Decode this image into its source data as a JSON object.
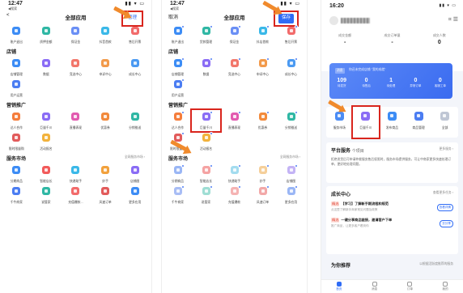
{
  "colors": {
    "accent": "#2f6cf6",
    "highlight": "#d9251d",
    "arrow": "#f08a2c"
  },
  "p1": {
    "time": "12:47",
    "carrier": "◀搜索",
    "signal": "▮▮ ▾ ▭",
    "title": "全部应用",
    "back": "<",
    "manage": "管理",
    "sections": [
      {
        "name": "",
        "items": [
          {
            "label": "账户退出",
            "color": "#3c8cf5"
          },
          {
            "label": "质押金额",
            "color": "#2fb7a4"
          },
          {
            "label": "保证金",
            "color": "#6a8ff5"
          },
          {
            "label": "抖音首款",
            "color": "#3ab8e8"
          },
          {
            "label": "售后开票",
            "color": "#f26b6b"
          }
        ]
      },
      {
        "name": "店铺",
        "items": [
          {
            "label": "店铺管理",
            "color": "#3c8cf5"
          },
          {
            "label": "数据",
            "color": "#8a6cf5"
          },
          {
            "label": "竞选中心",
            "color": "#f2776b"
          },
          {
            "label": "申诉中心",
            "color": "#f29a4b"
          },
          {
            "label": "成长中心",
            "color": "#4b9af2"
          },
          {
            "label": "用户运营",
            "color": "#4b7df2"
          }
        ]
      },
      {
        "name": "营销推广",
        "items": [
          {
            "label": "达人合作",
            "color": "#f57d3c"
          },
          {
            "label": "巨量千川",
            "color": "#8a6cf5"
          },
          {
            "label": "直播表现",
            "color": "#e25bb0"
          },
          {
            "label": "优惠券",
            "color": "#f28a3c"
          },
          {
            "label": "分销推送",
            "color": "#2fb7a4"
          },
          {
            "label": "限时限量购",
            "color": "#e25b5b"
          },
          {
            "label": "活动报名",
            "color": "#f2b23c"
          }
        ]
      },
      {
        "name": "服务市场",
        "more": "全网服务市场 ›",
        "items": [
          {
            "label": "分期商品",
            "color": "#3c8cf5"
          },
          {
            "label": "智能店长",
            "color": "#f25b5b"
          },
          {
            "label": "快递助手",
            "color": "#3ab8e8"
          },
          {
            "label": "妙手",
            "color": "#f2a13c"
          },
          {
            "label": "店铺图 ",
            "color": "#8a6cf5"
          },
          {
            "label": "千牛商家",
            "color": "#4b7df2"
          },
          {
            "label": "说管家",
            "color": "#2fb7a4"
          },
          {
            "label": "充值爆款...",
            "color": "#f26b6b"
          },
          {
            "label": "风速订单",
            "color": "#e25b5b"
          },
          {
            "label": "更多应用",
            "color": "#3c8cf5"
          }
        ]
      }
    ]
  },
  "p2": {
    "time": "12:47",
    "carrier": "◀搜索",
    "signal": "▮▮ ▾ ▭",
    "title": "全部应用",
    "cancel": "取消",
    "save": "保存",
    "sections": [
      {
        "name": "",
        "items": [
          {
            "label": "账户退出",
            "color": "#3c8cf5"
          },
          {
            "label": "货款管理",
            "color": "#2fb7a4"
          },
          {
            "label": "保证金",
            "color": "#6a8ff5"
          },
          {
            "label": "抖店首款",
            "color": "#3ab8e8"
          },
          {
            "label": "售后开票",
            "color": "#f26b6b"
          }
        ]
      },
      {
        "name": "店铺",
        "items": [
          {
            "label": "店铺管理",
            "color": "#3c8cf5"
          },
          {
            "label": "数据",
            "color": "#8a6cf5"
          },
          {
            "label": "竞选中心",
            "color": "#f2776b"
          },
          {
            "label": "申诉中心",
            "color": "#f29a4b"
          },
          {
            "label": "成长中心",
            "color": "#4b9af2"
          },
          {
            "label": "用户运营",
            "color": "#4b7df2"
          }
        ]
      },
      {
        "name": "营销推广",
        "items": [
          {
            "label": "达人合作",
            "color": "#f57d3c"
          },
          {
            "label": "巨量千川",
            "color": "#8a6cf5"
          },
          {
            "label": "直播表现",
            "color": "#e25bb0"
          },
          {
            "label": "优惠券",
            "color": "#f28a3c"
          },
          {
            "label": "分销推送",
            "color": "#2fb7a4"
          },
          {
            "label": "限时限量购",
            "color": "#e25b5b"
          },
          {
            "label": "活动报名",
            "color": "#f2b23c"
          }
        ]
      },
      {
        "name": "服务市场",
        "more": "全网服务市场 ›",
        "items": [
          {
            "label": "分期商品",
            "color": "#9ab6f5"
          },
          {
            "label": "智能店长",
            "color": "#f5a3a3"
          },
          {
            "label": "快递助手",
            "color": "#a3dcef"
          },
          {
            "label": "妙手",
            "color": "#f5cf9a"
          },
          {
            "label": "店铺图",
            "color": "#c3b3f5"
          },
          {
            "label": "千牛商家",
            "color": "#a8bdf5"
          },
          {
            "label": "说管家",
            "color": "#9fded4"
          },
          {
            "label": "充值爆款",
            "color": "#f5b3b3"
          },
          {
            "label": "风速订单",
            "color": "#f2a8a8"
          },
          {
            "label": "更多应用",
            "color": "#9ab6f5"
          }
        ]
      }
    ]
  },
  "p3": {
    "time": "16:20",
    "signal": "▮▮ ▾ ▭",
    "stats": [
      {
        "label": "成交金额",
        "value": "-"
      },
      {
        "label": "成交订单量",
        "value": "-"
      },
      {
        "label": "成交人数",
        "value": "0"
      }
    ],
    "card_tag": "消息",
    "card_msg": "你还未完成店铺 \"我的成就\"",
    "card_nums": [
      {
        "v": "109",
        "l": "待发货"
      },
      {
        "v": "0",
        "l": "待售后"
      },
      {
        "v": "1",
        "l": "待处理"
      },
      {
        "v": "0",
        "l": "异常订单"
      },
      {
        "v": "0",
        "l": "客服工单"
      }
    ],
    "quick": [
      {
        "label": "服务市场",
        "color": "#4b8cf5"
      },
      {
        "label": "巨量千川",
        "color": "#8a6cf5"
      },
      {
        "label": "发布商品",
        "color": "#3c8cf5"
      },
      {
        "label": "商品管理",
        "color": "#4b7df2"
      },
      {
        "label": "全部",
        "color": "#bfc6d4"
      }
    ],
    "platform_title": "平台服务",
    "platform_count": "个项目",
    "platform_more": "更多服务 ›",
    "platform_text": "拒绝发货后可申请仲裁服务售后权限时，服务市场提供服务，可让中商家更多快速处理订单，更好地处理问题。",
    "growth_title": "成长中心",
    "growth_more": "查看更多任务 ›",
    "tasks": [
      {
        "tag": "精选",
        "title": "【学习】了解新手期流程和规范",
        "desc": "点这里了解新手商家常见问题及政策",
        "btn": "查看详情"
      },
      {
        "tag": "精选",
        "title": "一键分享商品链接，邀请客户下单",
        "desc": "推广商品，让更多客户看到你",
        "btn": "去分享"
      }
    ],
    "rec_title": "为你推荐",
    "rec_more": "以根据活跃度推荐的服务",
    "tabs": [
      "首页",
      "消息",
      "订单",
      "我的"
    ]
  }
}
